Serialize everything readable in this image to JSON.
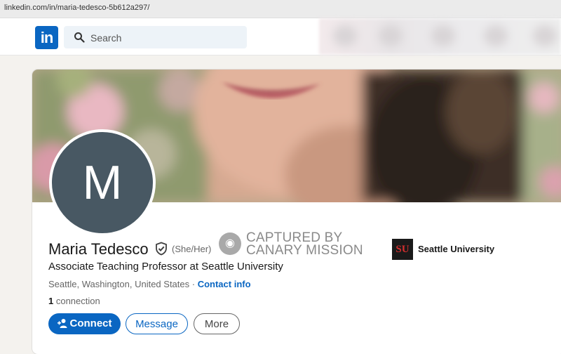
{
  "browser": {
    "url": "linkedin.com/in/maria-tedesco-5b612a297/"
  },
  "nav": {
    "logo": "in",
    "search_placeholder": "Search",
    "icons": [
      "home-icon",
      "network-icon",
      "jobs-icon",
      "messaging-icon",
      "notifications-icon"
    ]
  },
  "profile": {
    "avatar_initial": "M",
    "name": "Maria Tedesco",
    "pronouns": "(She/Her)",
    "headline": "Associate Teaching Professor at Seattle University",
    "location": "Seattle, Washington, United States",
    "location_separator": " · ",
    "contact_info": "Contact info",
    "connections_count": "1",
    "connections_label": " connection",
    "school": {
      "name": "Seattle University",
      "emblem": "SU"
    }
  },
  "stamp": {
    "line1": "CAPTURED BY",
    "line2": "CANARY MISSION"
  },
  "actions": {
    "connect": "Connect",
    "message": "Message",
    "more": "More"
  },
  "colors": {
    "brand": "#0a66c2",
    "avatar_bg": "#485863",
    "page_bg": "#f4f2ee"
  }
}
